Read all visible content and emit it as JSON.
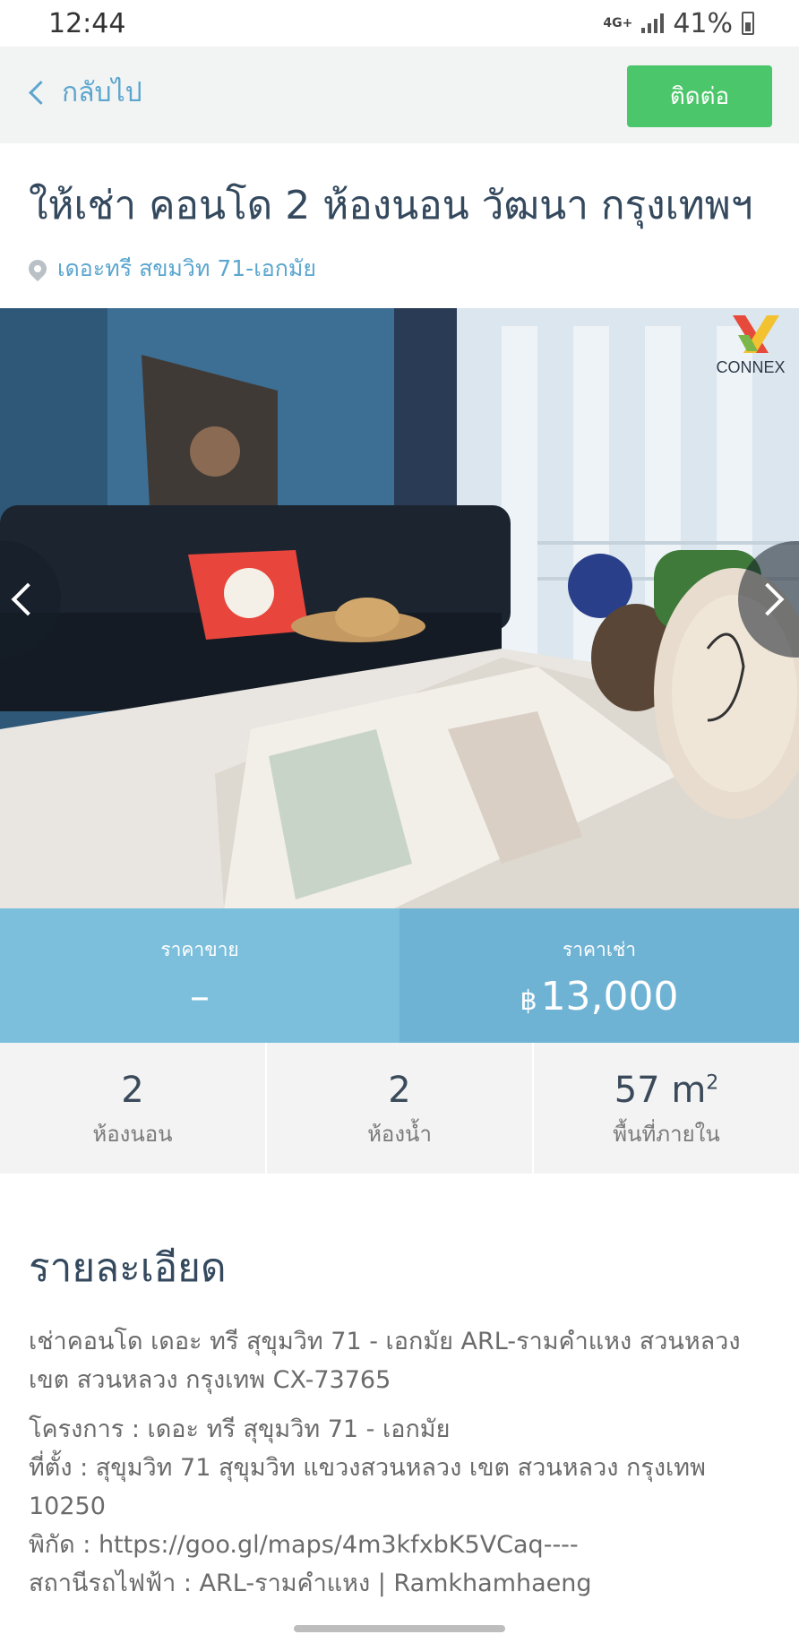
{
  "status_bar": {
    "time": "12:44",
    "network": "4G+",
    "battery": "41%"
  },
  "nav": {
    "back_label": "กลับไป",
    "contact_label": "ติดต่อ"
  },
  "listing": {
    "title": "ให้เช่า คอนโด 2 ห้องนอน วัฒนา กรุงเทพฯ",
    "location": "เดอะทรี สขมวิท 71-เอกมัย",
    "photo_watermark": "CONNEX"
  },
  "prices": {
    "sale_label": "ราคาขาย",
    "sale_value": "–",
    "rent_label": "ราคาเช่า",
    "currency": "฿",
    "rent_value": "13,000"
  },
  "stats": {
    "bedrooms": "2",
    "bedrooms_label": "ห้องนอน",
    "bathrooms": "2",
    "bathrooms_label": "ห้องน้ำ",
    "area": "57",
    "area_unit": "m",
    "area_sup": "2",
    "area_label": "พื้นที่ภายใน"
  },
  "details": {
    "heading": "รายละเอียด",
    "summary": "เช่าคอนโด เดอะ ทรี สุขุมวิท 71 - เอกมัย ARL-รามคำแหง สวนหลวง เขต สวนหลวง กรุงเทพ CX-73765",
    "project": "โครงการ : เดอะ ทรี สุขุมวิท 71 - เอกมัย",
    "address": "ที่ตั้ง : สุขุมวิท 71 สุขุมวิท แขวงสวนหลวง เขต สวนหลวง กรุงเทพ 10250",
    "coords": "พิกัด : https://goo.gl/maps/4m3kfxbK5VCaq----",
    "station": "สถานีรถไฟฟ้า : ARL-รามคำแหง | Ramkhamhaeng"
  }
}
